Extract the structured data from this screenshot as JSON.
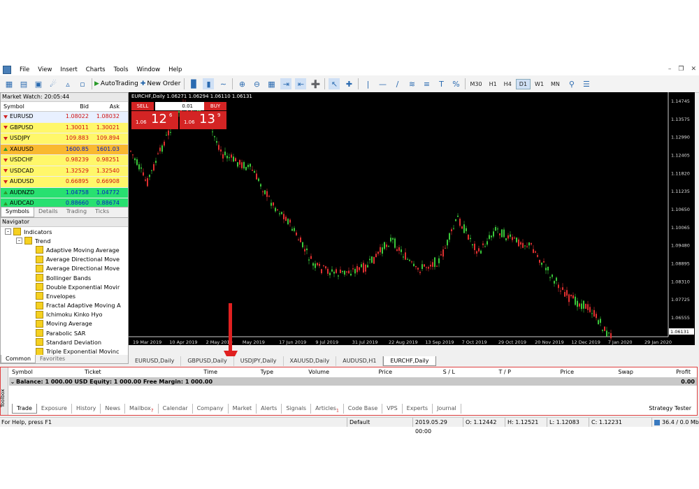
{
  "menu": {
    "items": [
      "File",
      "View",
      "Insert",
      "Charts",
      "Tools",
      "Window",
      "Help"
    ]
  },
  "toolbar": {
    "auto_trading": "AutoTrading",
    "new_order": "New Order",
    "timeframes": [
      "M30",
      "H1",
      "H4",
      "D1",
      "W1",
      "MN"
    ],
    "active_timeframe": "D1"
  },
  "market_watch": {
    "title": "Market Watch: 20:05:44",
    "headers": {
      "symbol": "Symbol",
      "bid": "Bid",
      "ask": "Ask"
    },
    "rows": [
      {
        "symbol": "EURUSD",
        "bid": "1.08022",
        "ask": "1.08032",
        "dir": "dn",
        "bg": "#e8f0ff"
      },
      {
        "symbol": "GBPUSD",
        "bid": "1.30011",
        "ask": "1.30021",
        "dir": "dn",
        "bg": "#fff76a"
      },
      {
        "symbol": "USDJPY",
        "bid": "109.883",
        "ask": "109.894",
        "dir": "dn",
        "bg": "#fff76a"
      },
      {
        "symbol": "XAUUSD",
        "bid": "1600.85",
        "ask": "1601.03",
        "dir": "up",
        "bg": "#f9b830"
      },
      {
        "symbol": "USDCHF",
        "bid": "0.98239",
        "ask": "0.98251",
        "dir": "dn",
        "bg": "#fff76a"
      },
      {
        "symbol": "USDCAD",
        "bid": "1.32529",
        "ask": "1.32540",
        "dir": "dn",
        "bg": "#fff76a"
      },
      {
        "symbol": "AUDUSD",
        "bid": "0.66895",
        "ask": "0.66908",
        "dir": "dn",
        "bg": "#fff76a"
      },
      {
        "symbol": "AUDNZD",
        "bid": "1.04758",
        "ask": "1.04772",
        "dir": "up",
        "bg": "#28e070"
      },
      {
        "symbol": "AUDCAD",
        "bid": "0.88660",
        "ask": "0.88674",
        "dir": "up",
        "bg": "#28e070"
      }
    ],
    "tabs": [
      "Symbols",
      "Details",
      "Trading",
      "Ticks"
    ]
  },
  "navigator": {
    "title": "Navigator",
    "root": "Indicators",
    "group": "Trend",
    "items": [
      "Adaptive Moving Average",
      "Average Directional Move",
      "Average Directional Move",
      "Bollinger Bands",
      "Double Exponential Movir",
      "Envelopes",
      "Fractal Adaptive Moving A",
      "Ichimoku Kinko Hyo",
      "Moving Average",
      "Parabolic SAR",
      "Standard Deviation",
      "Triple Exponential Movinc"
    ],
    "tabs": [
      "Common",
      "Favorites"
    ]
  },
  "chart": {
    "header": "EURCHF,Daily  1.06271 1.06294 1.06110 1.06131",
    "sell": "SELL",
    "buy": "BUY",
    "lot": "0.01",
    "sell_price": {
      "pre": "1.06",
      "big": "12",
      "sup": "6"
    },
    "buy_price": {
      "pre": "1.06",
      "big": "13",
      "sup": "9"
    },
    "yticks": [
      "1.14745",
      "1.13575",
      "1.12990",
      "1.12405",
      "1.11820",
      "1.11235",
      "1.10650",
      "1.10065",
      "1.09480",
      "1.08895",
      "1.08310",
      "1.07725",
      "1.06555"
    ],
    "last_price": "1.06131",
    "xticks": [
      "19 Mar 2019",
      "10 Apr 2019",
      "2 May 2019",
      "May 2019",
      "17 Jun 2019",
      "9 Jul 2019",
      "31 Jul 2019",
      "22 Aug 2019",
      "13 Sep 2019",
      "7 Oct 2019",
      "29 Oct 2019",
      "20 Nov 2019",
      "12 Dec 2019",
      "7 Jan 2020",
      "29 Jan 2020"
    ],
    "tabs": [
      "EURUSD,Daily",
      "GBPUSD,Daily",
      "USDJPY,Daily",
      "XAUUSD,Daily",
      "AUDUSD,H1",
      "EURCHF,Daily"
    ],
    "active_tab": "EURCHF,Daily"
  },
  "annotation": {
    "label": "Toolbox",
    "color": "#e02020"
  },
  "toolbox": {
    "side_label": "Toolbox",
    "headers": [
      "Symbol",
      "Ticket",
      "Time",
      "Type",
      "Volume",
      "Price",
      "S / L",
      "T / P",
      "Price",
      "Swap",
      "Profit"
    ],
    "balance_line": "Balance: 1 000.00 USD  Equity: 1 000.00  Free Margin: 1 000.00",
    "balance_profit": "0.00",
    "tabs": [
      "Trade",
      "Exposure",
      "History",
      "News",
      "Mailbox",
      "Calendar",
      "Company",
      "Market",
      "Alerts",
      "Signals",
      "Articles",
      "Code Base",
      "VPS",
      "Experts",
      "Journal"
    ],
    "mailbox_badge": "7",
    "articles_badge": "1",
    "strategy_tester": "Strategy Tester"
  },
  "status": {
    "help": "For Help, press F1",
    "profile": "Default",
    "datetime": "2019.05.29 00:00",
    "open": "O: 1.12442",
    "high": "H: 1.12521",
    "low": "L: 1.12083",
    "close": "C: 1.12231",
    "traffic": "36.4 / 0.0 Mb"
  }
}
